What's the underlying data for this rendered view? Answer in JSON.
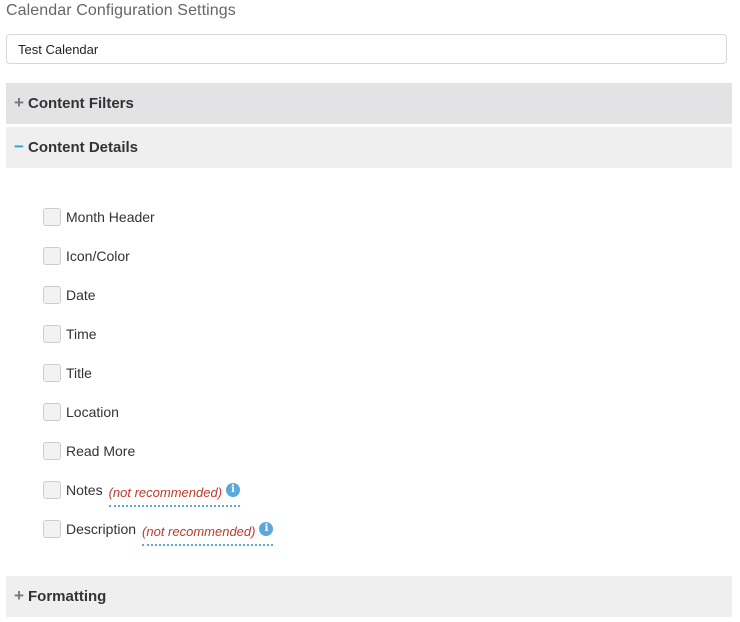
{
  "page": {
    "title": "Calendar Configuration Settings"
  },
  "calendar_name": {
    "value": "Test Calendar"
  },
  "sections": {
    "content_filters": {
      "label": "Content Filters",
      "state": "collapsed",
      "icon": "plus-icon"
    },
    "content_details": {
      "label": "Content Details",
      "state": "expanded",
      "icon": "minus-icon"
    },
    "formatting": {
      "label": "Formatting",
      "state": "collapsed",
      "icon": "plus-icon"
    }
  },
  "content_details": {
    "options": [
      {
        "label": "Month Header",
        "checked": false
      },
      {
        "label": "Icon/Color",
        "checked": false
      },
      {
        "label": "Date",
        "checked": false
      },
      {
        "label": "Time",
        "checked": false
      },
      {
        "label": "Title",
        "checked": false
      },
      {
        "label": "Location",
        "checked": false
      },
      {
        "label": "Read More",
        "checked": false
      },
      {
        "label": "Notes",
        "checked": false,
        "note": "(not recommended)"
      },
      {
        "label": "Description",
        "checked": false,
        "note": "(not recommended)"
      }
    ]
  },
  "colors": {
    "accent": "#2aa3db",
    "warning": "#c0392b",
    "info": "#5aa8dc"
  }
}
